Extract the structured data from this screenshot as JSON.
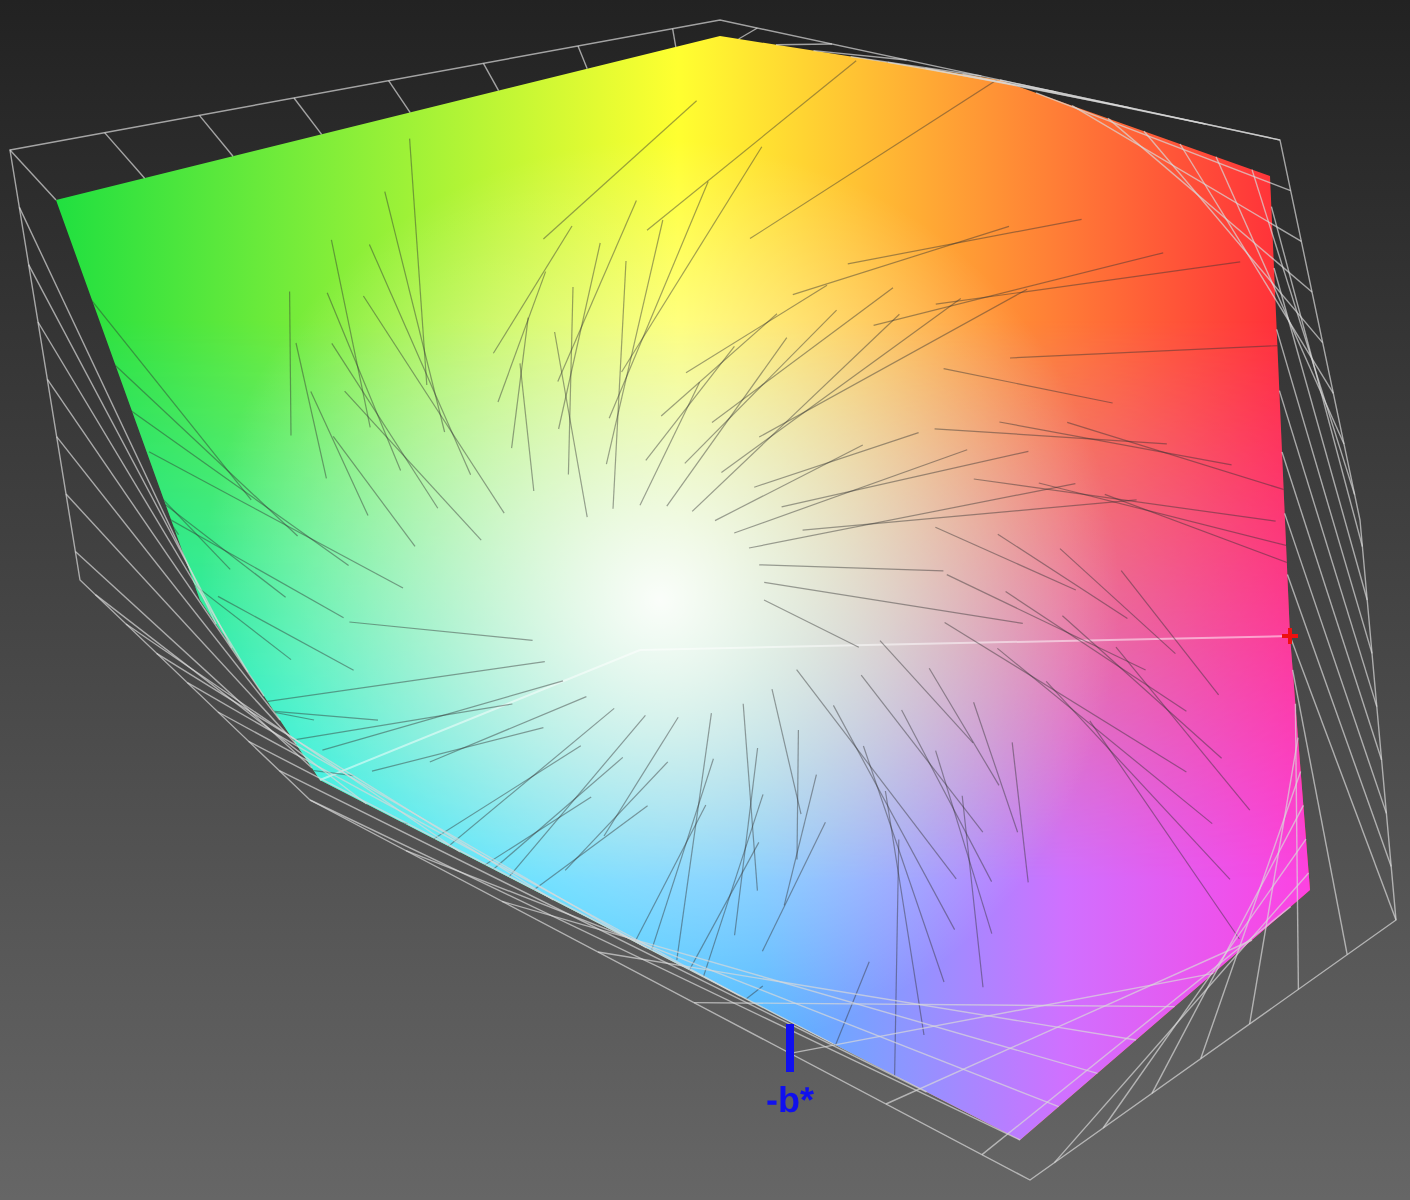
{
  "viewport": {
    "axis_label": "-b*"
  }
}
